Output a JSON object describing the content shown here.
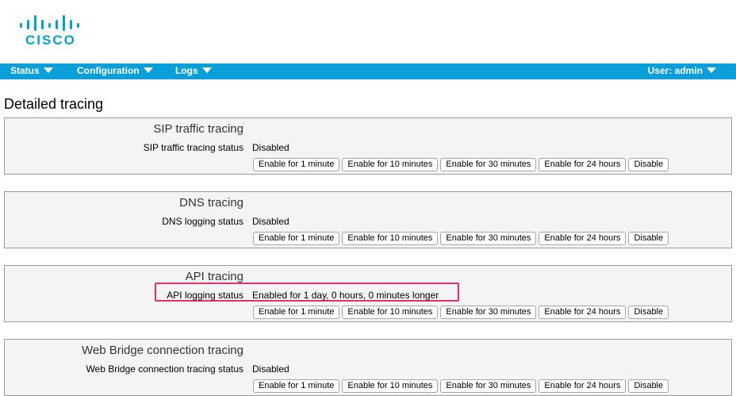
{
  "logo": {
    "text": "CISCO"
  },
  "nav": {
    "items": [
      {
        "label": "Status"
      },
      {
        "label": "Configuration"
      },
      {
        "label": "Logs"
      }
    ],
    "user_label": "User: admin"
  },
  "page": {
    "title": "Detailed tracing"
  },
  "panels": [
    {
      "title": "SIP traffic tracing",
      "status_label": "SIP traffic tracing status",
      "status_value": "Disabled",
      "buttons": [
        "Enable for 1 minute",
        "Enable for 10 minutes",
        "Enable for 30 minutes",
        "Enable for 24 hours",
        "Disable"
      ]
    },
    {
      "title": "DNS tracing",
      "status_label": "DNS logging status",
      "status_value": "Disabled",
      "buttons": [
        "Enable for 1 minute",
        "Enable for 10 minutes",
        "Enable for 30 minutes",
        "Enable for 24 hours",
        "Disable"
      ]
    },
    {
      "title": "API tracing",
      "status_label": "API logging status",
      "status_value": "Enabled for 1 day, 0 hours, 0 minutes longer",
      "highlighted": true,
      "buttons": [
        "Enable for 1 minute",
        "Enable for 10 minutes",
        "Enable for 30 minutes",
        "Enable for 24 hours",
        "Disable"
      ]
    },
    {
      "title": "Web Bridge connection tracing",
      "status_label": "Web Bridge connection tracing status",
      "status_value": "Disabled",
      "buttons": [
        "Enable for 1 minute",
        "Enable for 10 minutes",
        "Enable for 30 minutes",
        "Enable for 24 hours",
        "Disable"
      ]
    }
  ],
  "colors": {
    "nav_bar": "#0a9fd9",
    "logo": "#049fd9",
    "highlight_box": "#e8306a",
    "panel_bg": "#f4f4f4"
  }
}
